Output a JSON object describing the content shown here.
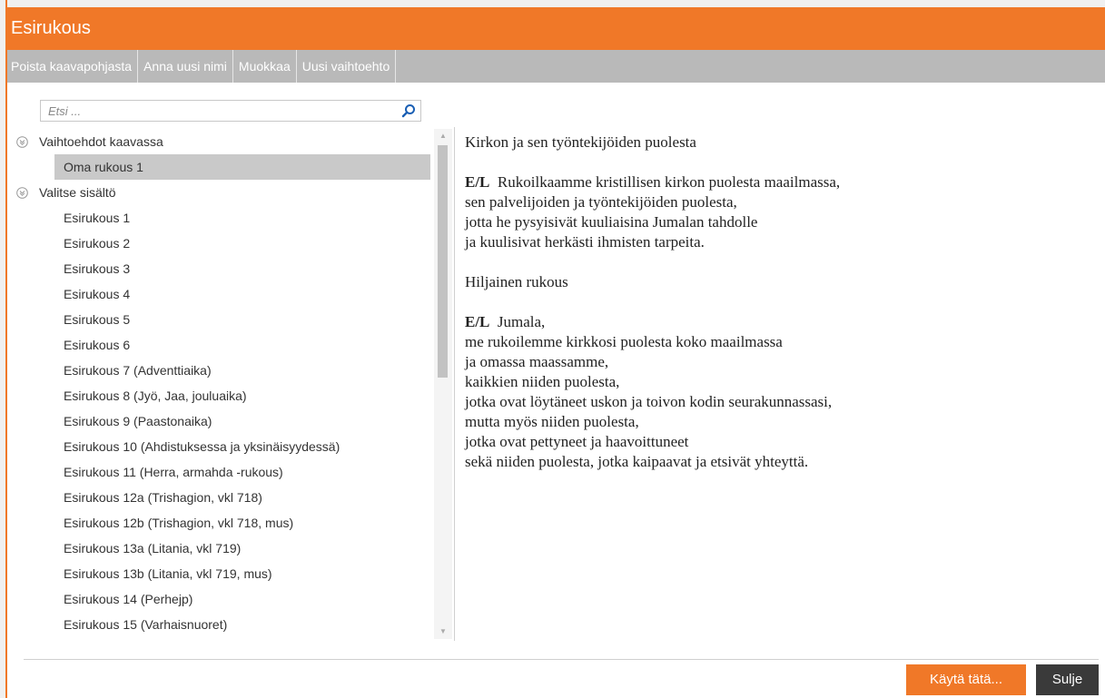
{
  "window": {
    "title": "Esirukous"
  },
  "toolbar": {
    "items": [
      "Poista kaavapohjasta",
      "Anna uusi nimi",
      "Muokkaa",
      "Uusi vaihtoehto"
    ]
  },
  "search": {
    "placeholder": "Etsi ..."
  },
  "tree": {
    "groups": [
      {
        "label": "Vaihtoehdot kaavassa",
        "items": [
          "Oma rukous 1"
        ],
        "selected_index": 0
      },
      {
        "label": "Valitse sisältö",
        "items": [
          "Esirukous 1",
          "Esirukous 2",
          "Esirukous 3",
          "Esirukous 4",
          "Esirukous 5",
          "Esirukous 6",
          "Esirukous 7 (Adventtiaika)",
          "Esirukous 8 (Jyö, Jaa, jouluaika)",
          "Esirukous 9 (Paastonaika)",
          "Esirukous 10 (Ahdistuksessa ja yksinäisyydessä)",
          "Esirukous 11 (Herra, armahda -rukous)",
          "Esirukous 12a (Trishagion, vkl 718)",
          "Esirukous 12b (Trishagion, vkl 718, mus)",
          "Esirukous 13a (Litania, vkl 719)",
          "Esirukous 13b (Litania, vkl 719, mus)",
          "Esirukous 14 (Perhejp)",
          "Esirukous 15 (Varhaisnuoret)"
        ]
      }
    ]
  },
  "preview": {
    "heading": "Kirkon ja sen työntekijöiden puolesta",
    "para1_speaker": "E/L",
    "para1_lines": [
      "Rukoilkaamme kristillisen kirkon puolesta maailmassa,",
      "sen palvelijoiden ja työntekijöiden puolesta,",
      "jotta he pysyisivät kuuliaisina Jumalan tahdolle",
      "ja kuulisivat herkästi ihmisten tarpeita."
    ],
    "silent": "Hiljainen rukous",
    "para2_speaker": "E/L",
    "para2_lines": [
      "Jumala,",
      "me rukoilemme kirkkosi puolesta koko maailmassa",
      "ja omassa maassamme,",
      "kaikkien niiden puolesta,",
      "jotka ovat löytäneet uskon ja toivon kodin seurakunnassasi,",
      "mutta myös niiden puolesta,",
      "jotka ovat pettyneet ja haavoittuneet",
      "sekä niiden puolesta, jotka kaipaavat ja etsivät yhteyttä."
    ]
  },
  "buttons": {
    "use": "Käytä tätä...",
    "close": "Sulje"
  },
  "colors": {
    "accent": "#f07828",
    "toolbar": "#b9b9b9",
    "selected": "#c9c9c9",
    "close_button": "#3a3a3a"
  }
}
